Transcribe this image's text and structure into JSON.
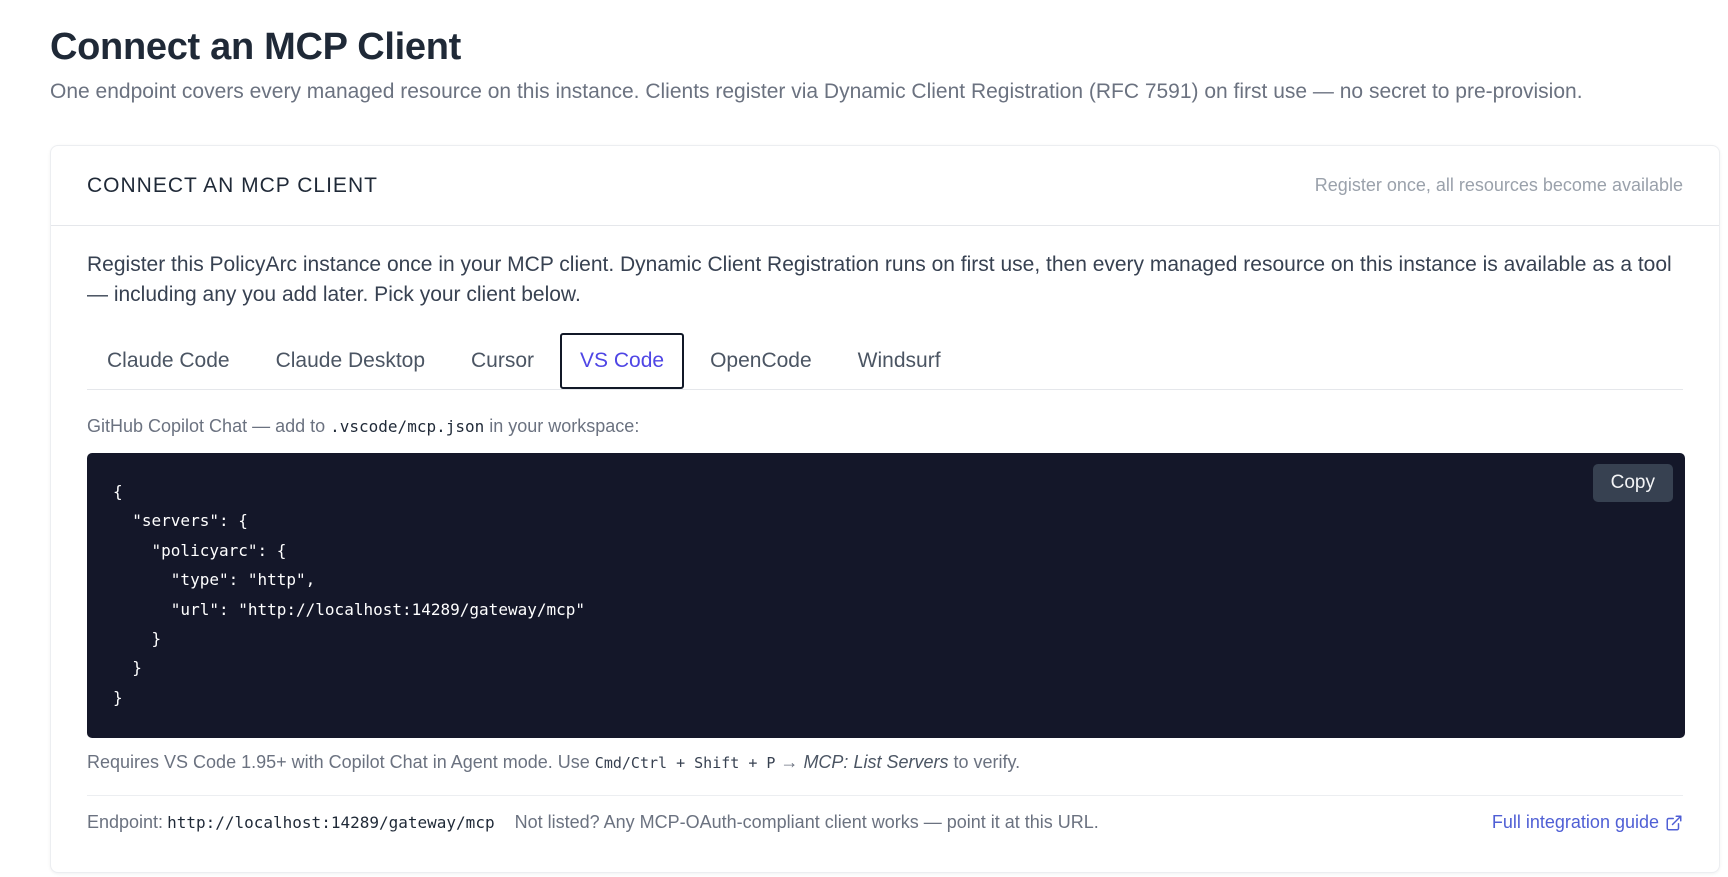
{
  "page": {
    "title": "Connect an MCP Client",
    "subtitle": "One endpoint covers every managed resource on this instance. Clients register via Dynamic Client Registration (RFC 7591) on first use — no secret to pre-provision."
  },
  "card": {
    "title": "CONNECT AN MCP CLIENT",
    "hint": "Register once, all resources become available",
    "intro": "Register this PolicyArc instance once in your MCP client. Dynamic Client Registration runs on first use, then every managed resource on this instance is available as a tool — including any you add later. Pick your client below.",
    "tabs": [
      {
        "label": "Claude Code",
        "active": false
      },
      {
        "label": "Claude Desktop",
        "active": false
      },
      {
        "label": "Cursor",
        "active": false
      },
      {
        "label": "VS Code",
        "active": true
      },
      {
        "label": "OpenCode",
        "active": false
      },
      {
        "label": "Windsurf",
        "active": false
      }
    ],
    "instruction": {
      "prefix": "GitHub Copilot Chat — add to ",
      "file": ".vscode/mcp.json",
      "suffix": " in your workspace:"
    },
    "code": "{\n  \"servers\": {\n    \"policyarc\": {\n      \"type\": \"http\",\n      \"url\": \"http://localhost:14289/gateway/mcp\"\n    }\n  }\n}",
    "copy_label": "Copy",
    "requires": {
      "prefix": "Requires VS Code 1.95+ with Copilot Chat in Agent mode. Use ",
      "shortcut": "Cmd/Ctrl + Shift + P",
      "arrow": " → ",
      "command": "MCP: List Servers",
      "suffix": " to verify."
    },
    "footer": {
      "endpoint_label": "Endpoint:",
      "endpoint_url": "http://localhost:14289/gateway/mcp",
      "note": "Not listed? Any MCP-OAuth-compliant client works — point it at this URL.",
      "guide_label": "Full integration guide"
    }
  },
  "colors": {
    "accent": "#4f46e5",
    "code_bg": "#141729",
    "copy_button": "#374151"
  }
}
